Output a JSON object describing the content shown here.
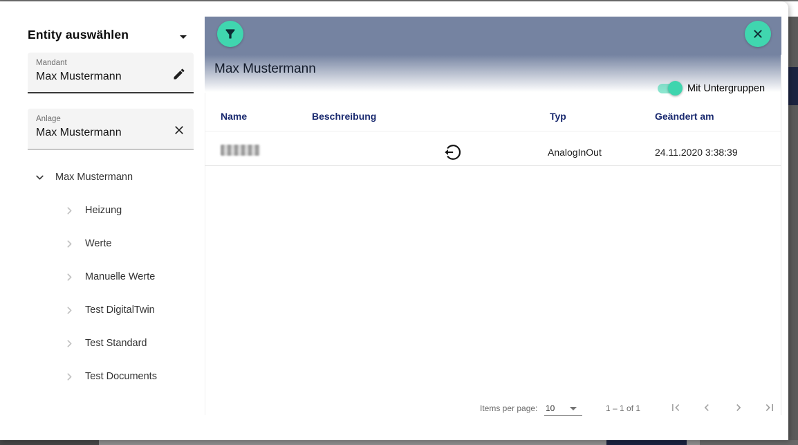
{
  "sidebar": {
    "title": "Entity auswählen",
    "fields": {
      "mandant": {
        "label": "Mandant",
        "value": "Max Mustermann"
      },
      "anlage": {
        "label": "Anlage",
        "value": "Max Mustermann"
      }
    },
    "tree": {
      "root": {
        "label": "Max Mustermann",
        "expanded": true
      },
      "children": [
        {
          "label": "Heizung"
        },
        {
          "label": "Werte"
        },
        {
          "label": "Manuelle Werte"
        },
        {
          "label": "Test DigitalTwin"
        },
        {
          "label": "Test Standard"
        },
        {
          "label": "Test Documents"
        }
      ]
    }
  },
  "panel": {
    "title": "Max Mustermann",
    "subgroups_toggle": {
      "label": "Mit Untergruppen",
      "state": "on"
    },
    "table": {
      "columns": [
        {
          "label": "Name"
        },
        {
          "label": "Beschreibung"
        },
        {
          "label": "Typ"
        },
        {
          "label": "Geändert am"
        }
      ],
      "rows": [
        {
          "name_redacted": true,
          "beschreibung_icon": "arrow-out-of-circle-left",
          "typ": "AnalogInOut",
          "geaendert_am": "24.11.2020 3:38:39"
        }
      ]
    },
    "paginator": {
      "items_per_page_label": "Items per page:",
      "page_size": "10",
      "range": "1 – 1 of 1"
    }
  },
  "icons": {
    "sidebar_collapse": "caret-down",
    "mandant_edit": "pencil",
    "anlage_clear": "x-clear",
    "tree_expanded": "chevron-down",
    "tree_collapsed": "chevron-right",
    "panel_filter": "funnel",
    "panel_close": "x-close",
    "row_type": "arrow-out-of-circle-left",
    "paginator": [
      "first-page",
      "previous-page",
      "next-page",
      "last-page"
    ]
  },
  "colors": {
    "accent_teal": "#40d6af",
    "header_slate": "#7583a1",
    "table_header_text": "#19296f",
    "frame_navy": "#1b2340"
  }
}
